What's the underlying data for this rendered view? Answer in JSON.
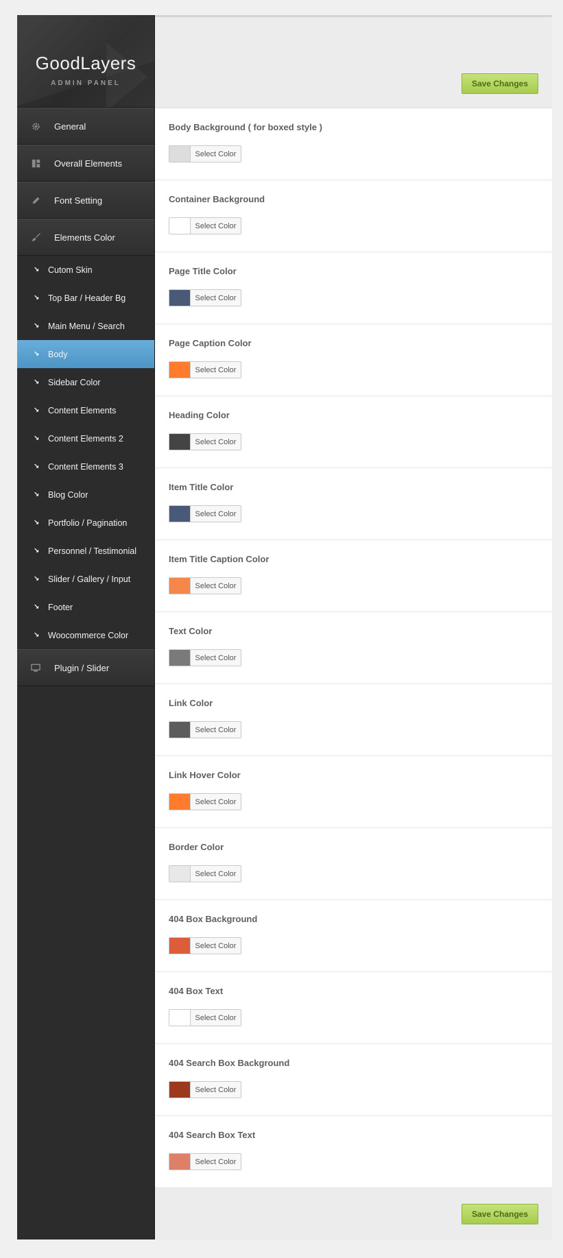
{
  "logo": {
    "title": "GoodLayers",
    "subtitle": "ADMIN PANEL"
  },
  "sidebar": {
    "main_items": [
      {
        "label": "General",
        "icon": "gear-icon"
      },
      {
        "label": "Overall Elements",
        "icon": "layout-icon"
      },
      {
        "label": "Font Setting",
        "icon": "pencil-icon"
      },
      {
        "label": "Elements Color",
        "icon": "brush-icon"
      }
    ],
    "sub_items": [
      {
        "label": "Cutom Skin"
      },
      {
        "label": "Top Bar / Header Bg"
      },
      {
        "label": "Main Menu / Search"
      },
      {
        "label": "Body",
        "active": true
      },
      {
        "label": "Sidebar Color"
      },
      {
        "label": "Content Elements"
      },
      {
        "label": "Content Elements 2"
      },
      {
        "label": "Content Elements 3"
      },
      {
        "label": "Blog Color"
      },
      {
        "label": "Portfolio / Pagination"
      },
      {
        "label": "Personnel / Testimonial"
      },
      {
        "label": "Slider / Gallery / Input"
      },
      {
        "label": "Footer"
      },
      {
        "label": "Woocommerce Color"
      }
    ],
    "last_item": {
      "label": "Plugin / Slider",
      "icon": "monitor-icon"
    }
  },
  "toolbar": {
    "save_label": "Save Changes",
    "save_label_bottom": "Save Changes"
  },
  "picker_label": "Select Color",
  "color_options": [
    {
      "label": "Body Background ( for boxed style )",
      "color": "#dddddd"
    },
    {
      "label": "Container Background",
      "color": "#ffffff"
    },
    {
      "label": "Page Title Color",
      "color": "#485a78"
    },
    {
      "label": "Page Caption Color",
      "color": "#ff7b2e"
    },
    {
      "label": "Heading Color",
      "color": "#444444"
    },
    {
      "label": "Item Title Color",
      "color": "#485a78"
    },
    {
      "label": "Item Title Caption Color",
      "color": "#f5874a"
    },
    {
      "label": "Text Color",
      "color": "#7a7a7a"
    },
    {
      "label": "Link Color",
      "color": "#5c5c5c"
    },
    {
      "label": "Link Hover Color",
      "color": "#ff7b2e"
    },
    {
      "label": "Border Color",
      "color": "#e8e8e8"
    },
    {
      "label": "404 Box Background",
      "color": "#dc5d3c"
    },
    {
      "label": "404 Box Text",
      "color": "#ffffff"
    },
    {
      "label": "404 Search Box Background",
      "color": "#9c3a20"
    },
    {
      "label": "404 Search Box Text",
      "color": "#de8068"
    }
  ]
}
